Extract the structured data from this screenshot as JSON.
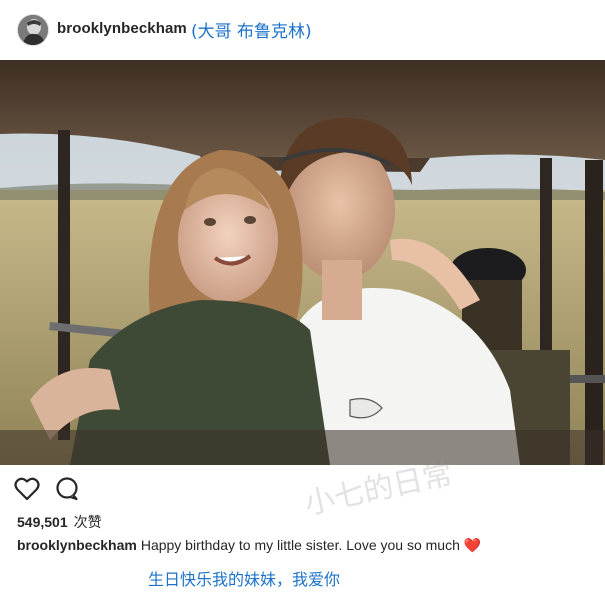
{
  "post": {
    "username": "brooklynbeckham",
    "username_translation": "(大哥 布鲁克林)",
    "avatar_icon": "profile-avatar",
    "likes_count": "549,501",
    "likes_suffix": "次赞",
    "caption_user": "brooklynbeckham",
    "caption_text": "Happy birthday to my little sister. Love you so much",
    "caption_emoji": "❤️",
    "caption_translation": "生日快乐我的妹妹，我爱你",
    "watermark_text": "小七的日常"
  },
  "actions": {
    "like_icon": "heart-outline-icon",
    "comment_icon": "comment-bubble-icon"
  },
  "colors": {
    "accent_blue": "#1e73c9",
    "heart_red": "#e02020",
    "text": "#262626"
  }
}
